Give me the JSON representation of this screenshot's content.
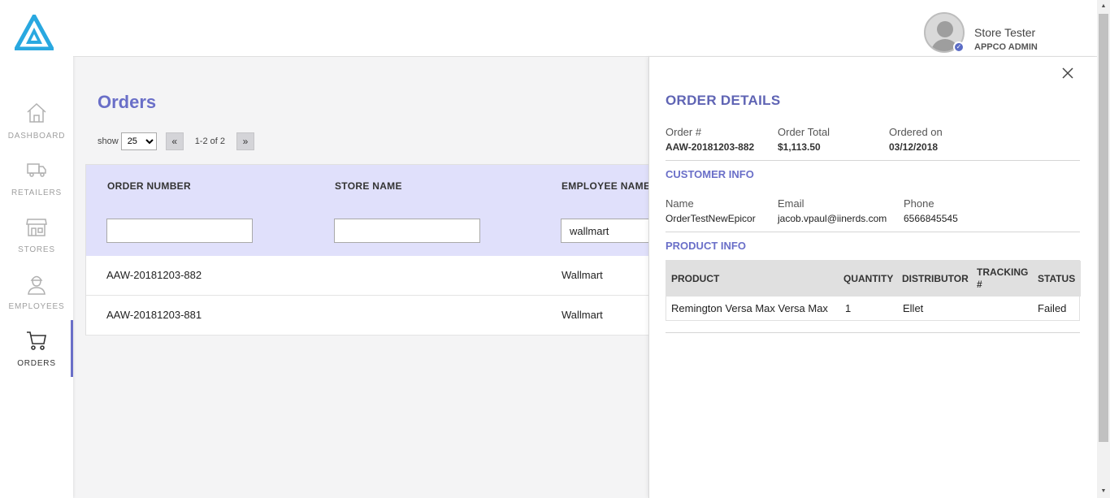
{
  "sidebar": {
    "items": [
      {
        "label": "DASHBOARD",
        "icon": "home-icon"
      },
      {
        "label": "RETAILERS",
        "icon": "truck-icon"
      },
      {
        "label": "STORES",
        "icon": "store-icon"
      },
      {
        "label": "EMPLOYEES",
        "icon": "employee-icon"
      },
      {
        "label": "ORDERS",
        "icon": "cart-icon",
        "active": true
      }
    ]
  },
  "user": {
    "name": "Store Tester",
    "role": "APPCO ADMIN"
  },
  "page": {
    "title": "Orders"
  },
  "pager": {
    "show_label": "show",
    "page_size": "25",
    "prev": "«",
    "next": "»",
    "range": "1-2 of 2"
  },
  "orders_table": {
    "columns": [
      "ORDER NUMBER",
      "STORE NAME",
      "EMPLOYEE NAME"
    ],
    "filters": {
      "order_number": "",
      "store_name": "",
      "employee_name": "wallmart"
    },
    "rows": [
      {
        "order_number": "AAW-20181203-882",
        "store_name": "",
        "employee_name": "Wallmart"
      },
      {
        "order_number": "AAW-20181203-881",
        "store_name": "",
        "employee_name": "Wallmart"
      }
    ]
  },
  "order_details": {
    "title": "ORDER DETAILS",
    "order_no_label": "Order #",
    "order_no": "AAW-20181203-882",
    "total_label": "Order Total",
    "total": "$1,113.50",
    "ordered_on_label": "Ordered on",
    "ordered_on": "03/12/2018",
    "customer_section": "CUSTOMER INFO",
    "name_label": "Name",
    "name": "OrderTestNewEpicor",
    "email_label": "Email",
    "email": "jacob.vpaul@iinerds.com",
    "phone_label": "Phone",
    "phone": "6566845545",
    "product_section": "PRODUCT INFO",
    "product_columns": [
      "PRODUCT",
      "QUANTITY",
      "DISTRIBUTOR",
      "TRACKING #",
      "STATUS"
    ],
    "products": [
      {
        "product": "Remington Versa Max Versa Max",
        "quantity": "1",
        "distributor": "Ellet",
        "tracking": "",
        "status": "Failed"
      }
    ]
  },
  "colors": {
    "accent": "#6a6fc8",
    "header_bg": "#e0e0fb",
    "logo": "#29a8e0"
  }
}
